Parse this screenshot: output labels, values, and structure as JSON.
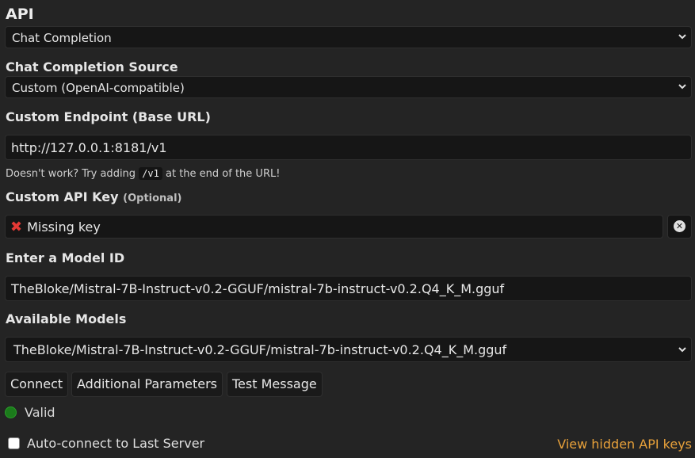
{
  "api": {
    "heading": "API",
    "selected": "Chat Completion"
  },
  "source": {
    "heading": "Chat Completion Source",
    "selected": "Custom (OpenAI-compatible)"
  },
  "endpoint": {
    "heading": "Custom Endpoint (Base URL)",
    "value": "http://127.0.0.1:8181/v1",
    "hint_prefix": "Doesn't work? Try adding",
    "hint_code": "/v1",
    "hint_suffix": "at the end of the URL!"
  },
  "api_key": {
    "heading": "Custom API Key",
    "optional": "(Optional)",
    "placeholder": "Missing key",
    "status_icon": "cross-mark-icon"
  },
  "model_id": {
    "heading": "Enter a Model ID",
    "value": "TheBloke/Mistral-7B-Instruct-v0.2-GGUF/mistral-7b-instruct-v0.2.Q4_K_M.gguf"
  },
  "available_models": {
    "heading": "Available Models",
    "selected": "TheBloke/Mistral-7B-Instruct-v0.2-GGUF/mistral-7b-instruct-v0.2.Q4_K_M.gguf"
  },
  "buttons": {
    "connect": "Connect",
    "additional": "Additional Parameters",
    "test": "Test Message"
  },
  "status": {
    "label": "Valid",
    "color": "#1b7b1b"
  },
  "auto_connect": {
    "label": "Auto-connect to Last Server",
    "checked": false
  },
  "link": {
    "label": "View hidden API keys",
    "color": "#e8a13a"
  }
}
